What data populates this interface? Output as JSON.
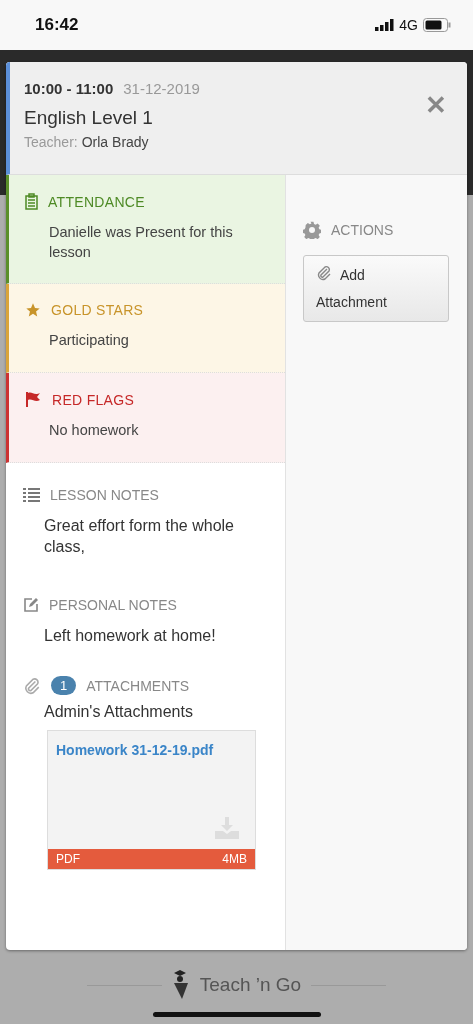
{
  "status_bar": {
    "time": "16:42",
    "network": "4G"
  },
  "lesson": {
    "time": "10:00 - 11:00",
    "date": "31-12-2019",
    "title": "English Level 1",
    "teacher_label": "Teacher:",
    "teacher": "Orla Brady",
    "close": "✕"
  },
  "records": [
    {
      "kind": "attendance",
      "title": "ATTENDANCE",
      "text": "Danielle was Present for this lesson"
    },
    {
      "kind": "gold",
      "title": "GOLD STARS",
      "text": "Participating"
    },
    {
      "kind": "red",
      "title": "RED FLAGS",
      "text": "No homework"
    }
  ],
  "notes": [
    {
      "kind": "lesson",
      "title": "LESSON NOTES",
      "text": "Great effort form the whole class,"
    },
    {
      "kind": "personal",
      "title": "PERSONAL NOTES",
      "text": "Left homework at home!"
    }
  ],
  "attachments": {
    "count": "1",
    "title": "ATTACHMENTS",
    "group": "Admin's Attachments",
    "files": [
      {
        "name": "Homework 31-12-19.pdf",
        "type": "PDF",
        "size": "4MB"
      }
    ]
  },
  "actions": {
    "title": "ACTIONS",
    "buttons": [
      "Add Attachment"
    ]
  },
  "footer": {
    "brand": "Teach ’n Go"
  }
}
